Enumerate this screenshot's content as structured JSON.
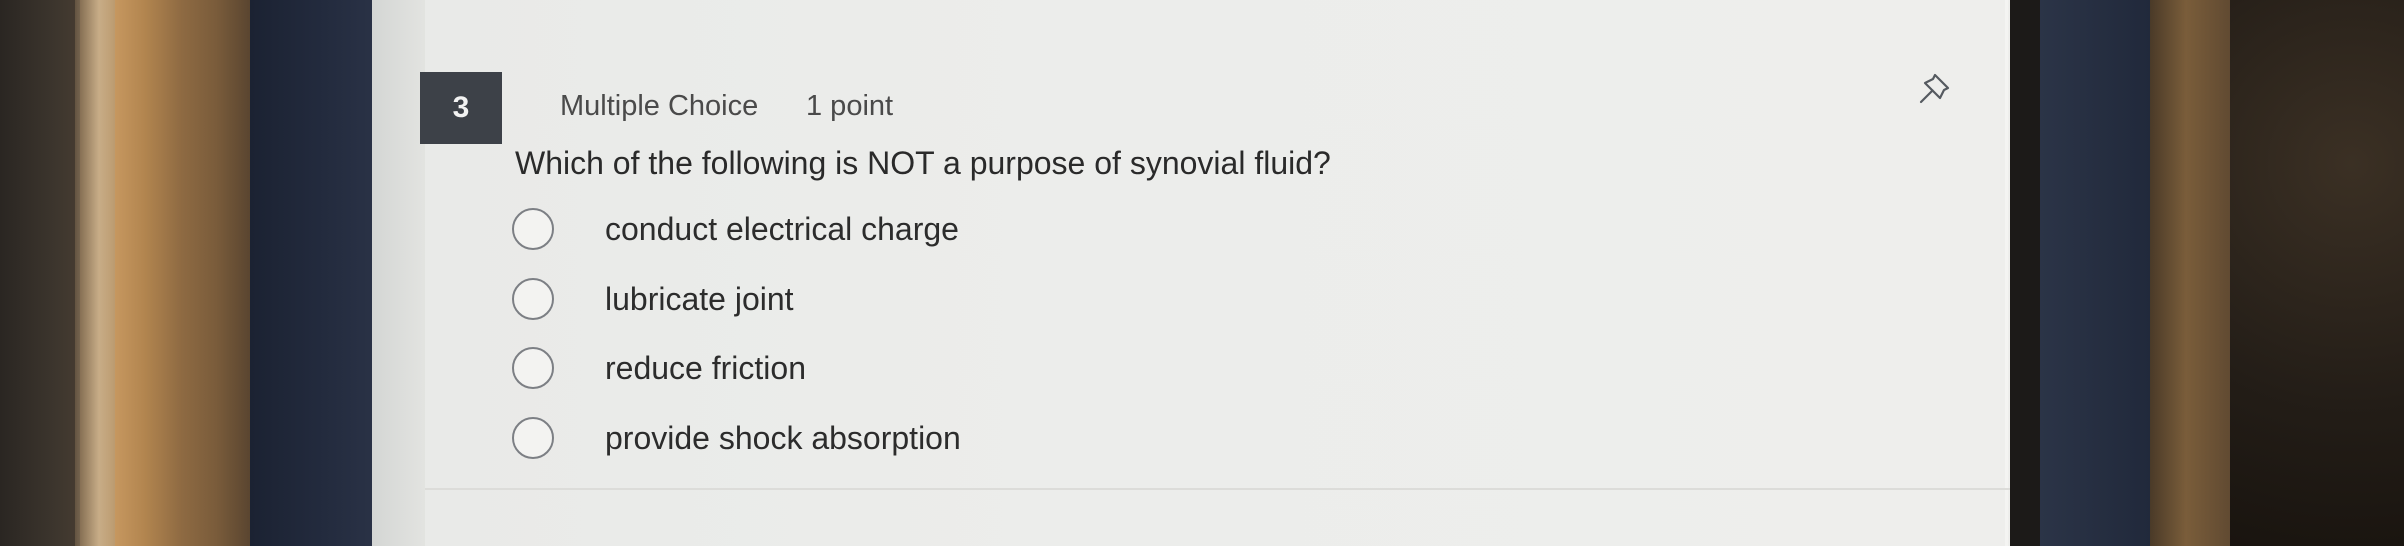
{
  "question": {
    "number": "3",
    "type": "Multiple Choice",
    "points": "1 point",
    "text": "Which of the following is NOT a purpose of synovial fluid?"
  },
  "options": [
    {
      "label": "conduct electrical charge"
    },
    {
      "label": "lubricate joint"
    },
    {
      "label": "reduce friction"
    },
    {
      "label": "provide shock absorption"
    }
  ],
  "icons": {
    "pin": "pin-icon"
  },
  "colors": {
    "number_badge": "#3d4148",
    "background": "#ecedeb"
  }
}
